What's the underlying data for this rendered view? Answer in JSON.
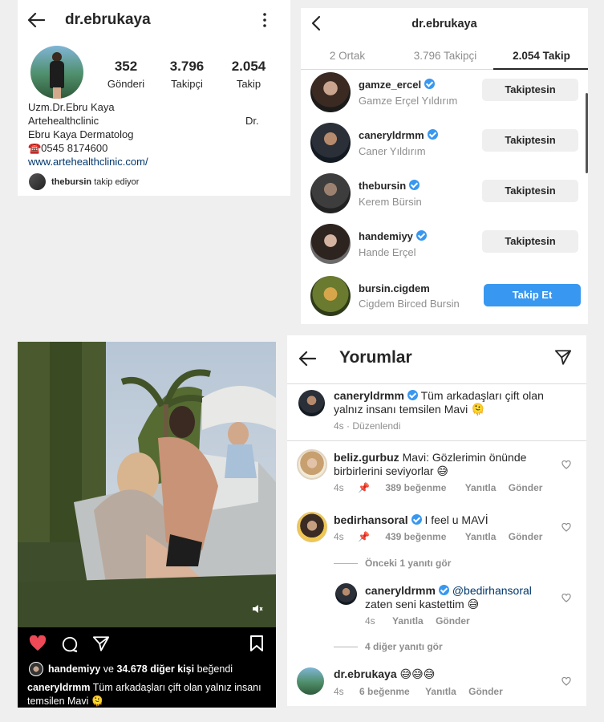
{
  "profile": {
    "username": "dr.ebrukaya",
    "stats": [
      {
        "value": "352",
        "label": "Gönderi"
      },
      {
        "value": "3.796",
        "label": "Takipçi"
      },
      {
        "value": "2.054",
        "label": "Takip"
      }
    ],
    "bio": {
      "name": "Uzm.Dr.Ebru Kaya",
      "line2": "Artehealthclinic",
      "line2_right": "Dr.",
      "line3": "Ebru Kaya Dermatolog",
      "phone": "☎️0545 8174600",
      "link": "www.artehealthclinic.com/"
    },
    "followed_by_user": "thebursin",
    "followed_by_text": "takip ediyor"
  },
  "following": {
    "title": "dr.ebrukaya",
    "tabs": [
      "2 Ortak",
      "3.796 Takipçi",
      "2.054 Takip"
    ],
    "active_tab": 2,
    "rows": [
      {
        "username": "gamze_ercel",
        "fullname": "Gamze Erçel Yıldırım",
        "verified": true,
        "button": "Takiptesin"
      },
      {
        "username": "caneryldrmm",
        "fullname": "Caner Yıldırım",
        "verified": true,
        "button": "Takiptesin"
      },
      {
        "username": "thebursin",
        "fullname": "Kerem Bürsin",
        "verified": true,
        "button": "Takiptesin"
      },
      {
        "username": "handemiyy",
        "fullname": "Hande Erçel",
        "verified": true,
        "button": "Takiptesin"
      },
      {
        "username": "bursin.cigdem",
        "fullname": "Cigdem Birced Bursin",
        "verified": false,
        "button": "Takip Et"
      }
    ]
  },
  "post": {
    "liked_by_user": "handemiyy",
    "liked_mid": "ve",
    "liked_others": "34.678 diğer kişi",
    "liked_suffix": "beğendi",
    "caption_user": "caneryldrmm",
    "caption_line1": "Tüm arkadaşları çift olan yalnız insanı",
    "caption_line2": "temsilen Mavi 🫠"
  },
  "comments": {
    "title": "Yorumlar",
    "caption": {
      "user": "caneryldrmm",
      "text1": "Tüm arkadaşları çift olan",
      "text2": "yalnız insanı temsilen Mavi 🫠",
      "time": "4s",
      "edited": "Düzenlendi"
    },
    "items": [
      {
        "user": "beliz.gurbuz",
        "text1": "Mavi: Gözlerimin önünde",
        "text2": "birbirlerini seviyorlar 😅",
        "time": "4s",
        "likes": "389 beğenme",
        "reply": "Yanıtla",
        "send": "Gönder"
      },
      {
        "user": "bedirhansoral",
        "text1": "I feel u MAVİ",
        "time": "4s",
        "likes": "439 beğenme",
        "reply": "Yanıtla",
        "send": "Gönder"
      }
    ],
    "view_prev": "Önceki 1 yanıtı gör",
    "reply": {
      "user": "caneryldrmm",
      "mention": "@bedirhansoral",
      "text2": "zaten seni kastettim 😅",
      "time": "4s",
      "reply": "Yanıtla",
      "send": "Gönder"
    },
    "view_more": "4 diğer yanıtı gör",
    "last": {
      "user": "dr.ebrukaya",
      "text": "😅😅😅",
      "time": "4s",
      "likes": "6 beğenme",
      "reply": "Yanıtla",
      "send": "Gönder"
    }
  },
  "colors": {
    "accent": "#3897f0",
    "heart": "#ed4956",
    "muted": "#8e8e8e"
  }
}
